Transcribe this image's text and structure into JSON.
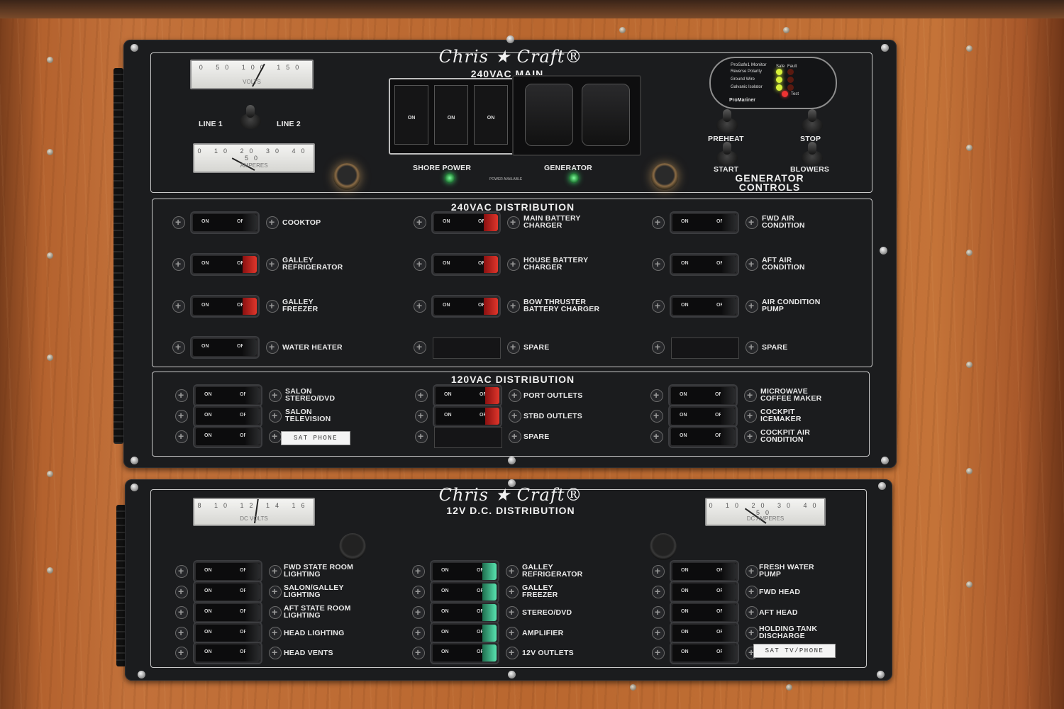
{
  "upper_panel": {
    "brand": "Chris ★ Craft®",
    "header": "240VAC MAIN",
    "meters": [
      {
        "scale": "0 50 100 150",
        "unit": "VOLTS"
      },
      {
        "scale": "0 10 20 30 40 50",
        "unit": "AMPERES"
      }
    ],
    "line_labels": {
      "line1": "LINE 1",
      "line2": "LINE 2"
    },
    "breaker_labels": [
      "ON",
      "ON",
      "ON"
    ],
    "shore_power": "SHORE POWER",
    "generator": "GENERATOR",
    "power_available": "POWER AVAILABLE",
    "monitor": {
      "title": "ProSafe1 Monitor",
      "rows": [
        "Reverse Polarity",
        "Ground Wire",
        "Galvanic Isolator"
      ],
      "col_labels": [
        "Safe",
        "Fault"
      ],
      "test": "Test",
      "brand": "ProMariner"
    },
    "gen_controls": {
      "preheat": "PREHEAT",
      "stop": "STOP",
      "start": "START",
      "blowers": "BLOWERS",
      "title_line1": "GENERATOR",
      "title_line2": "CONTROLS"
    },
    "ac240": {
      "title": "240VAC DISTRIBUTION",
      "col1": [
        "COOKTOP",
        "GALLEY\nREFRIGERATOR",
        "GALLEY\nFREEZER",
        "WATER HEATER"
      ],
      "col2": [
        "MAIN BATTERY\nCHARGER",
        "HOUSE BATTERY\nCHARGER",
        "BOW THRUSTER\nBATTERY CHARGER",
        "SPARE"
      ],
      "col3": [
        "FWD AIR\nCONDITION",
        "AFT AIR\nCONDITION",
        "AIR CONDITION\nPUMP",
        "SPARE"
      ]
    },
    "ac120": {
      "title": "120VAC DISTRIBUTION",
      "col1": [
        "SALON\nSTEREO/DVD",
        "SALON\nTELEVISION"
      ],
      "sat_phone": "SAT PHONE",
      "col2": [
        "PORT OUTLETS",
        "STBD OUTLETS",
        "SPARE"
      ],
      "col3": [
        "MICROWAVE\nCOFFEE MAKER",
        "COCKPIT\nICEMAKER",
        "COCKPIT AIR\nCONDITION"
      ]
    }
  },
  "lower_panel": {
    "brand": "Chris ★ Craft®",
    "title": "12V D.C. DISTRIBUTION",
    "meters": [
      {
        "scale": "8 10 12 14 16",
        "unit": "DC VOLTS"
      },
      {
        "scale": "0 10 20 30 40 50",
        "unit": "DC AMPERES"
      }
    ],
    "col1": [
      "FWD STATE ROOM\nLIGHTING",
      "SALON/GALLEY\nLIGHTING",
      "AFT STATE ROOM\nLIGHTING",
      "HEAD LIGHTING",
      "HEAD VENTS"
    ],
    "col2": [
      "GALLEY\nREFRIGERATOR",
      "GALLEY\nFREEZER",
      "STEREO/DVD",
      "AMPLIFIER",
      "12V OUTLETS"
    ],
    "col3": [
      "FRESH WATER\nPUMP",
      "FWD HEAD",
      "AFT HEAD",
      "HOLDING TANK\nDISCHARGE"
    ],
    "sat_tv_phone": "SAT TV/PHONE"
  },
  "switch_text": {
    "on": "ON",
    "off": "OFF"
  },
  "colors": {
    "red_tab": "#e0362b",
    "green_tab": "#58e4b0",
    "panel": "#1b1c1e",
    "wood": "#c2713a"
  }
}
